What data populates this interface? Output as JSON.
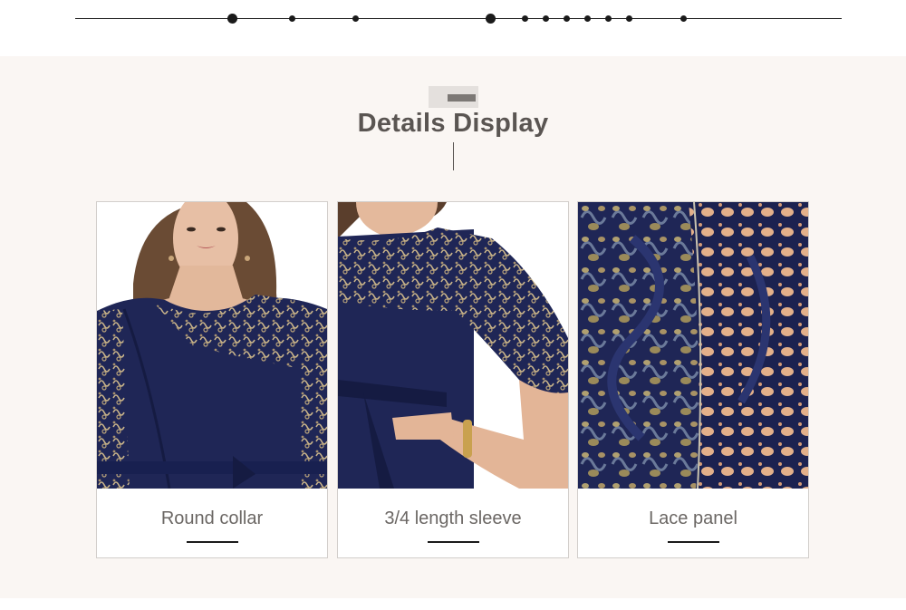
{
  "section": {
    "title": "Details Display"
  },
  "cards": [
    {
      "label": "Round collar",
      "image": "woman-round-collar-photo"
    },
    {
      "label": "3/4 length sleeve",
      "image": "lace-sleeve-photo"
    },
    {
      "label": "Lace panel",
      "image": "lace-closeup-photo"
    }
  ],
  "colors": {
    "dress_navy": "#1f2656",
    "lace_gold": "#b8a27a",
    "section_bg": "#faf6f3",
    "title_text": "#5a5552"
  }
}
